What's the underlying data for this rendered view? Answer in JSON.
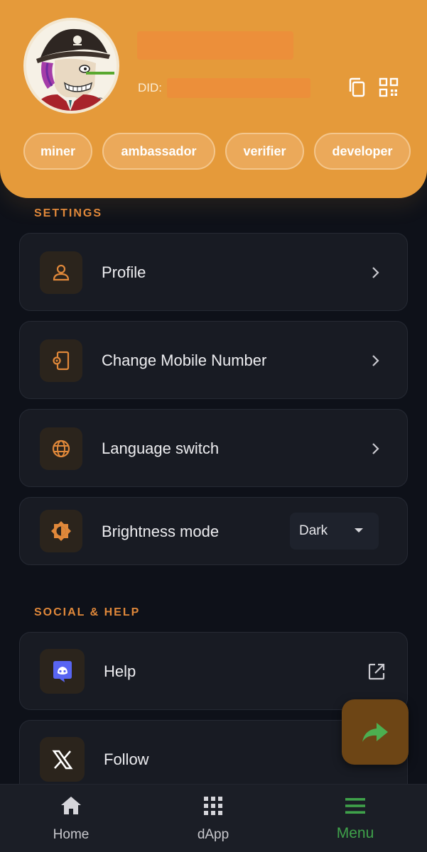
{
  "header": {
    "did_label": "DID:",
    "tags": [
      "miner",
      "ambassador",
      "verifier",
      "developer"
    ]
  },
  "settings": {
    "title": "SETTINGS",
    "items": [
      {
        "label": "Profile",
        "icon": "person-icon"
      },
      {
        "label": "Change Mobile Number",
        "icon": "mobile-settings-icon"
      },
      {
        "label": "Language switch",
        "icon": "globe-icon"
      },
      {
        "label": "Brightness mode",
        "icon": "brightness-icon",
        "value": "Dark"
      }
    ]
  },
  "social": {
    "title": "SOCIAL & HELP",
    "items": [
      {
        "label": "Help",
        "icon": "discord-icon"
      },
      {
        "label": "Follow",
        "icon": "x-logo-icon"
      }
    ]
  },
  "nav": {
    "items": [
      {
        "label": "Home",
        "icon": "home-icon"
      },
      {
        "label": "dApp",
        "icon": "grid-icon"
      },
      {
        "label": "Menu",
        "icon": "menu-icon",
        "active": true
      }
    ]
  },
  "colors": {
    "accent": "#e59a3a",
    "section_title": "#e0883a",
    "active_nav": "#3fa14a",
    "background": "#0e1119",
    "card": "#181b23"
  }
}
